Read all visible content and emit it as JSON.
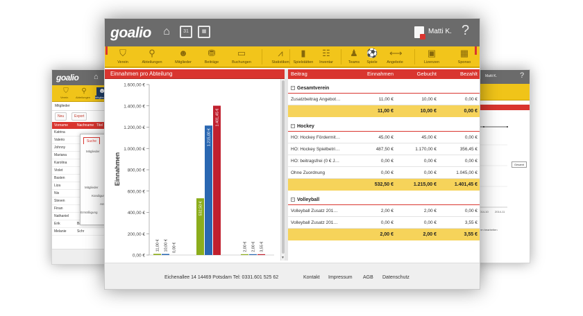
{
  "app": {
    "logo": "goalio",
    "user": "Matti K.",
    "help": "?"
  },
  "topbar_icons": [
    {
      "name": "home-icon",
      "glyph": "⌂"
    },
    {
      "name": "calendar-icon",
      "glyph": "31"
    },
    {
      "name": "grid-icon",
      "glyph": "▦"
    }
  ],
  "nav": [
    {
      "label": "Verein",
      "icon": "shield-icon",
      "glyph": "⛉"
    },
    {
      "label": "Abteilungen",
      "icon": "org-chart-icon",
      "glyph": "⚲"
    },
    {
      "label": "Mitglieder",
      "icon": "people-icon",
      "glyph": "☻"
    },
    {
      "label": "Beiträge",
      "icon": "coins-icon",
      "glyph": "⛃"
    },
    {
      "label": "Buchungen",
      "icon": "banknote-icon",
      "glyph": "▭"
    },
    {
      "label": "Statistiken",
      "icon": "chart-icon",
      "glyph": "⩘"
    },
    {
      "label": "Spielstätten",
      "icon": "building-icon",
      "glyph": "▮"
    },
    {
      "label": "Inventar",
      "icon": "inventory-icon",
      "glyph": "☷"
    },
    {
      "label": "Teams",
      "icon": "teams-icon",
      "glyph": "♟"
    },
    {
      "label": "Spiele",
      "icon": "ball-icon",
      "glyph": "⚽"
    },
    {
      "label": "Angebote",
      "icon": "arrows-icon",
      "glyph": "⟷"
    },
    {
      "label": "Lizenzen",
      "icon": "license-icon",
      "glyph": "▣"
    },
    {
      "label": "Sponso",
      "icon": "sponsor-icon",
      "glyph": "▦"
    }
  ],
  "chart_panel": {
    "title": "Einnahmen pro Abteilung"
  },
  "chart_data": {
    "type": "bar",
    "title": "Einnahmen pro Abteilung",
    "ylabel": "Einnahmen",
    "ylim": [
      0,
      1600
    ],
    "yticks": [
      "0,00 €",
      "200,00 €",
      "400,00 €",
      "600,00 €",
      "800,00 €",
      "1.000,00 €",
      "1.200,00 €",
      "1.400,00 €",
      "1.600,00 €"
    ],
    "bars": [
      {
        "value": 11.0,
        "label": "11,00 €",
        "color": "#8cad1c"
      },
      {
        "value": 10.0,
        "label": "10,00 €",
        "color": "#2a67b1"
      },
      {
        "value": 0.0,
        "label": "0,00 €",
        "color": "#c0202e"
      },
      {
        "value": 532.5,
        "label": "532,50 €",
        "color": "#8cad1c"
      },
      {
        "value": 1215.0,
        "label": "1.215,00 €",
        "color": "#2a67b1"
      },
      {
        "value": 1401.45,
        "label": "1.401,45 €",
        "color": "#c0202e"
      },
      {
        "value": 2.0,
        "label": "2,00 €",
        "color": "#8cad1c"
      },
      {
        "value": 2.0,
        "label": "2,00 €",
        "color": "#2a67b1"
      },
      {
        "value": 3.55,
        "label": "3,55 €",
        "color": "#c0202e"
      }
    ]
  },
  "table": {
    "columns": [
      "Beitrag",
      "Einnahmen",
      "Gebucht",
      "Bezahlt"
    ],
    "groups": [
      {
        "name": "Gesamtverein",
        "rows": [
          [
            "Zusatzbeitrag Angebot…",
            "11,00 €",
            "10,00 €",
            "0,00 €"
          ]
        ],
        "sum": [
          "11,00 €",
          "10,00 €",
          "0,00 €"
        ]
      },
      {
        "name": "Hockey",
        "rows": [
          [
            "HO: Hockey Fördermit…",
            "45,00 €",
            "45,00 €",
            "0,00 €"
          ],
          [
            "HO: Hockey Spielbetri…",
            "487,50 €",
            "1.170,00 €",
            "356,45 €"
          ],
          [
            "HO: beitragsfrei (0 € J…",
            "0,00 €",
            "0,00 €",
            "0,00 €"
          ],
          [
            "Ohne Zuordnung",
            "0,00 €",
            "0,00 €",
            "1.045,00 €"
          ]
        ],
        "sum": [
          "532,50 €",
          "1.215,00 €",
          "1.401,45 €"
        ]
      },
      {
        "name": "Volleyball",
        "rows": [
          [
            "Volleyball Zusatz 201…",
            "2,00 €",
            "2,00 €",
            "0,00 €"
          ],
          [
            "Volleyball Zusatz 201…",
            "0,00 €",
            "0,00 €",
            "3,55 €"
          ]
        ],
        "sum": [
          "2,00 €",
          "2,00 €",
          "3,55 €"
        ]
      }
    ]
  },
  "footer": {
    "address": "Eichenallee 14   14469 Potsdam   Tel: 0331.601 525 62",
    "links": [
      "Kontakt",
      "Impressum",
      "AGB",
      "Datenschutz"
    ]
  },
  "back_left": {
    "logo": "goalio",
    "nav": [
      "Verein",
      "Abteilungen",
      "Mitglieder"
    ],
    "section": "Mitglieder",
    "buttons": [
      "Neu",
      "Export"
    ],
    "columns": [
      "Vorname",
      "Nachname",
      "Titel"
    ],
    "rows": [
      [
        "Katrina",
        ""
      ],
      [
        "Valerio",
        ""
      ],
      [
        "Johnny",
        ""
      ],
      [
        "Mariana",
        ""
      ],
      [
        "Karolina",
        ""
      ],
      [
        "Violet",
        ""
      ],
      [
        "Basten",
        ""
      ],
      [
        "Liza",
        ""
      ],
      [
        "Nis",
        ""
      ],
      [
        "Steven",
        ""
      ],
      [
        "Finan",
        ""
      ],
      [
        "Nathaniel",
        ""
      ],
      [
        "Erik",
        "Baum"
      ],
      [
        "Melanie",
        "Schr"
      ]
    ],
    "modal": {
      "tab": "Suche",
      "lines": [
        "Mitglieder",
        "Mitglieder",
        "Kündigun",
        "Ant",
        "Ermäßigung"
      ]
    },
    "footer": "Eiche"
  },
  "back_right": {
    "user": "Matti K.",
    "legend": "Gesamt",
    "axis": [
      "2014-10",
      "2014-11"
    ],
    "note": "Mitgliedern bearbeiten",
    "footer": "rotokoll"
  }
}
